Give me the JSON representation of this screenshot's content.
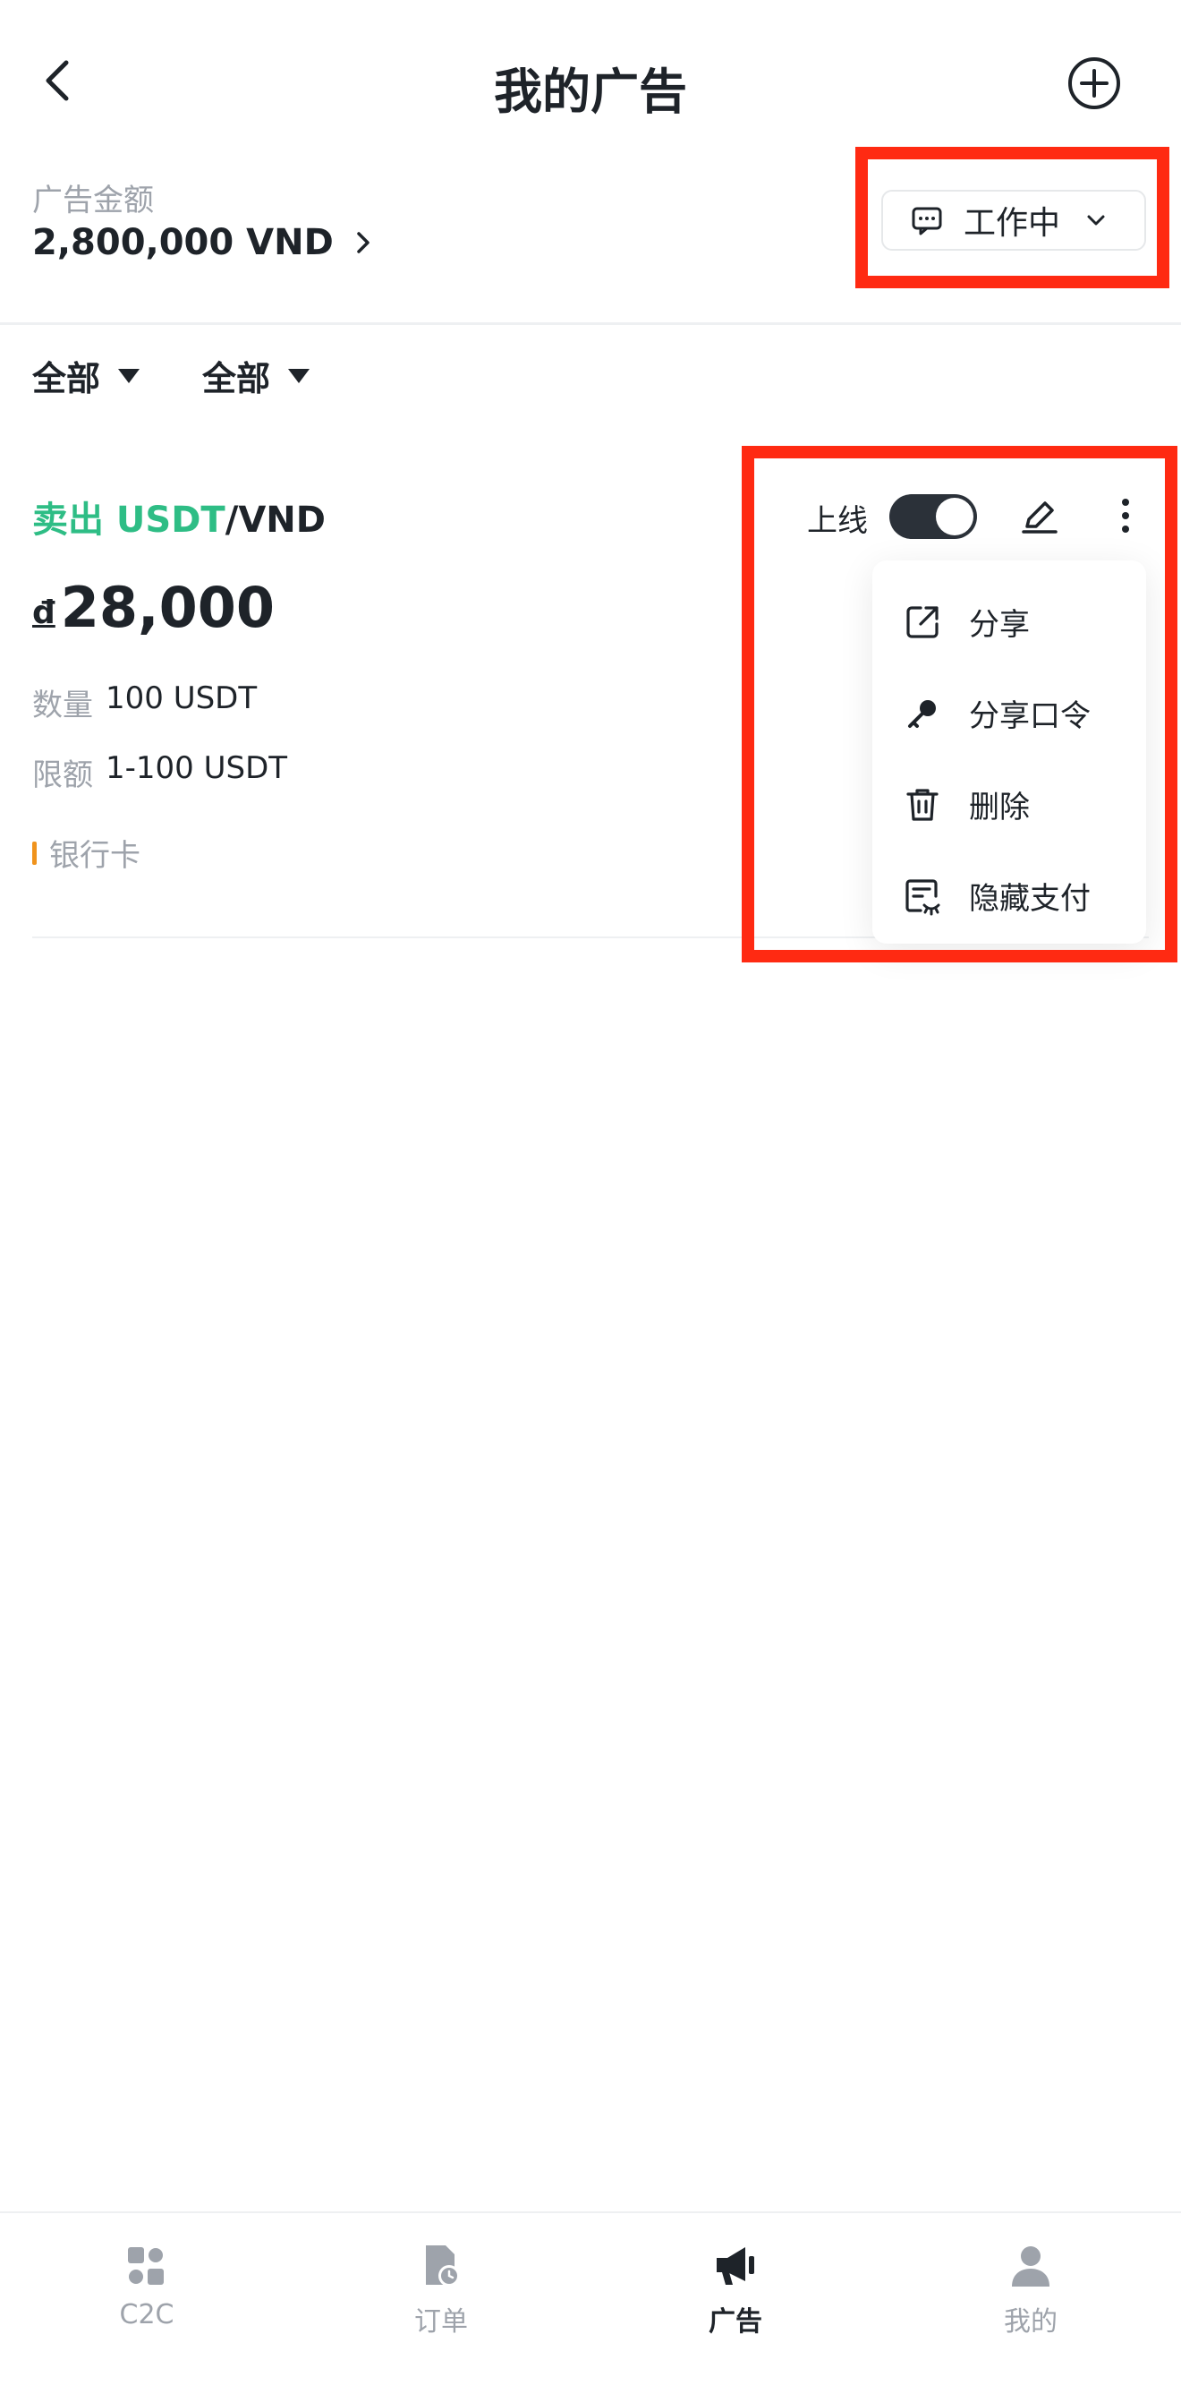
{
  "header": {
    "title": "我的广告",
    "back_icon": "chevron-left-icon",
    "add_icon": "plus-circle-icon"
  },
  "summary": {
    "amount_label": "广告金额",
    "amount_value": "2,800,000 VND",
    "status_label": "工作中",
    "status_icon": "message-icon"
  },
  "filters": [
    {
      "label": "全部"
    },
    {
      "label": "全部"
    }
  ],
  "ad": {
    "side": "卖出 USDT",
    "pair_rest": "/VND",
    "currency_symbol": "đ",
    "price": "28,000",
    "quantity_label": "数量",
    "quantity_value": "100 USDT",
    "limit_label": "限额",
    "limit_value": "1-100 USDT",
    "payment_method": "银行卡",
    "online_label": "上线",
    "online": true,
    "side_color": "#2ebd85",
    "payment_color": "#f0931c"
  },
  "menu": {
    "items": [
      {
        "label": "分享",
        "icon": "share-icon"
      },
      {
        "label": "分享口令",
        "icon": "key-icon"
      },
      {
        "label": "删除",
        "icon": "trash-icon"
      },
      {
        "label": "隐藏支付",
        "icon": "hide-payment-icon"
      }
    ]
  },
  "tabbar": {
    "items": [
      {
        "label": "C2C",
        "icon": "c2c-icon",
        "active": false
      },
      {
        "label": "订单",
        "icon": "orders-icon",
        "active": false
      },
      {
        "label": "广告",
        "icon": "megaphone-icon",
        "active": true
      },
      {
        "label": "我的",
        "icon": "user-icon",
        "active": false
      }
    ]
  },
  "highlight_color": "#ff2a12"
}
